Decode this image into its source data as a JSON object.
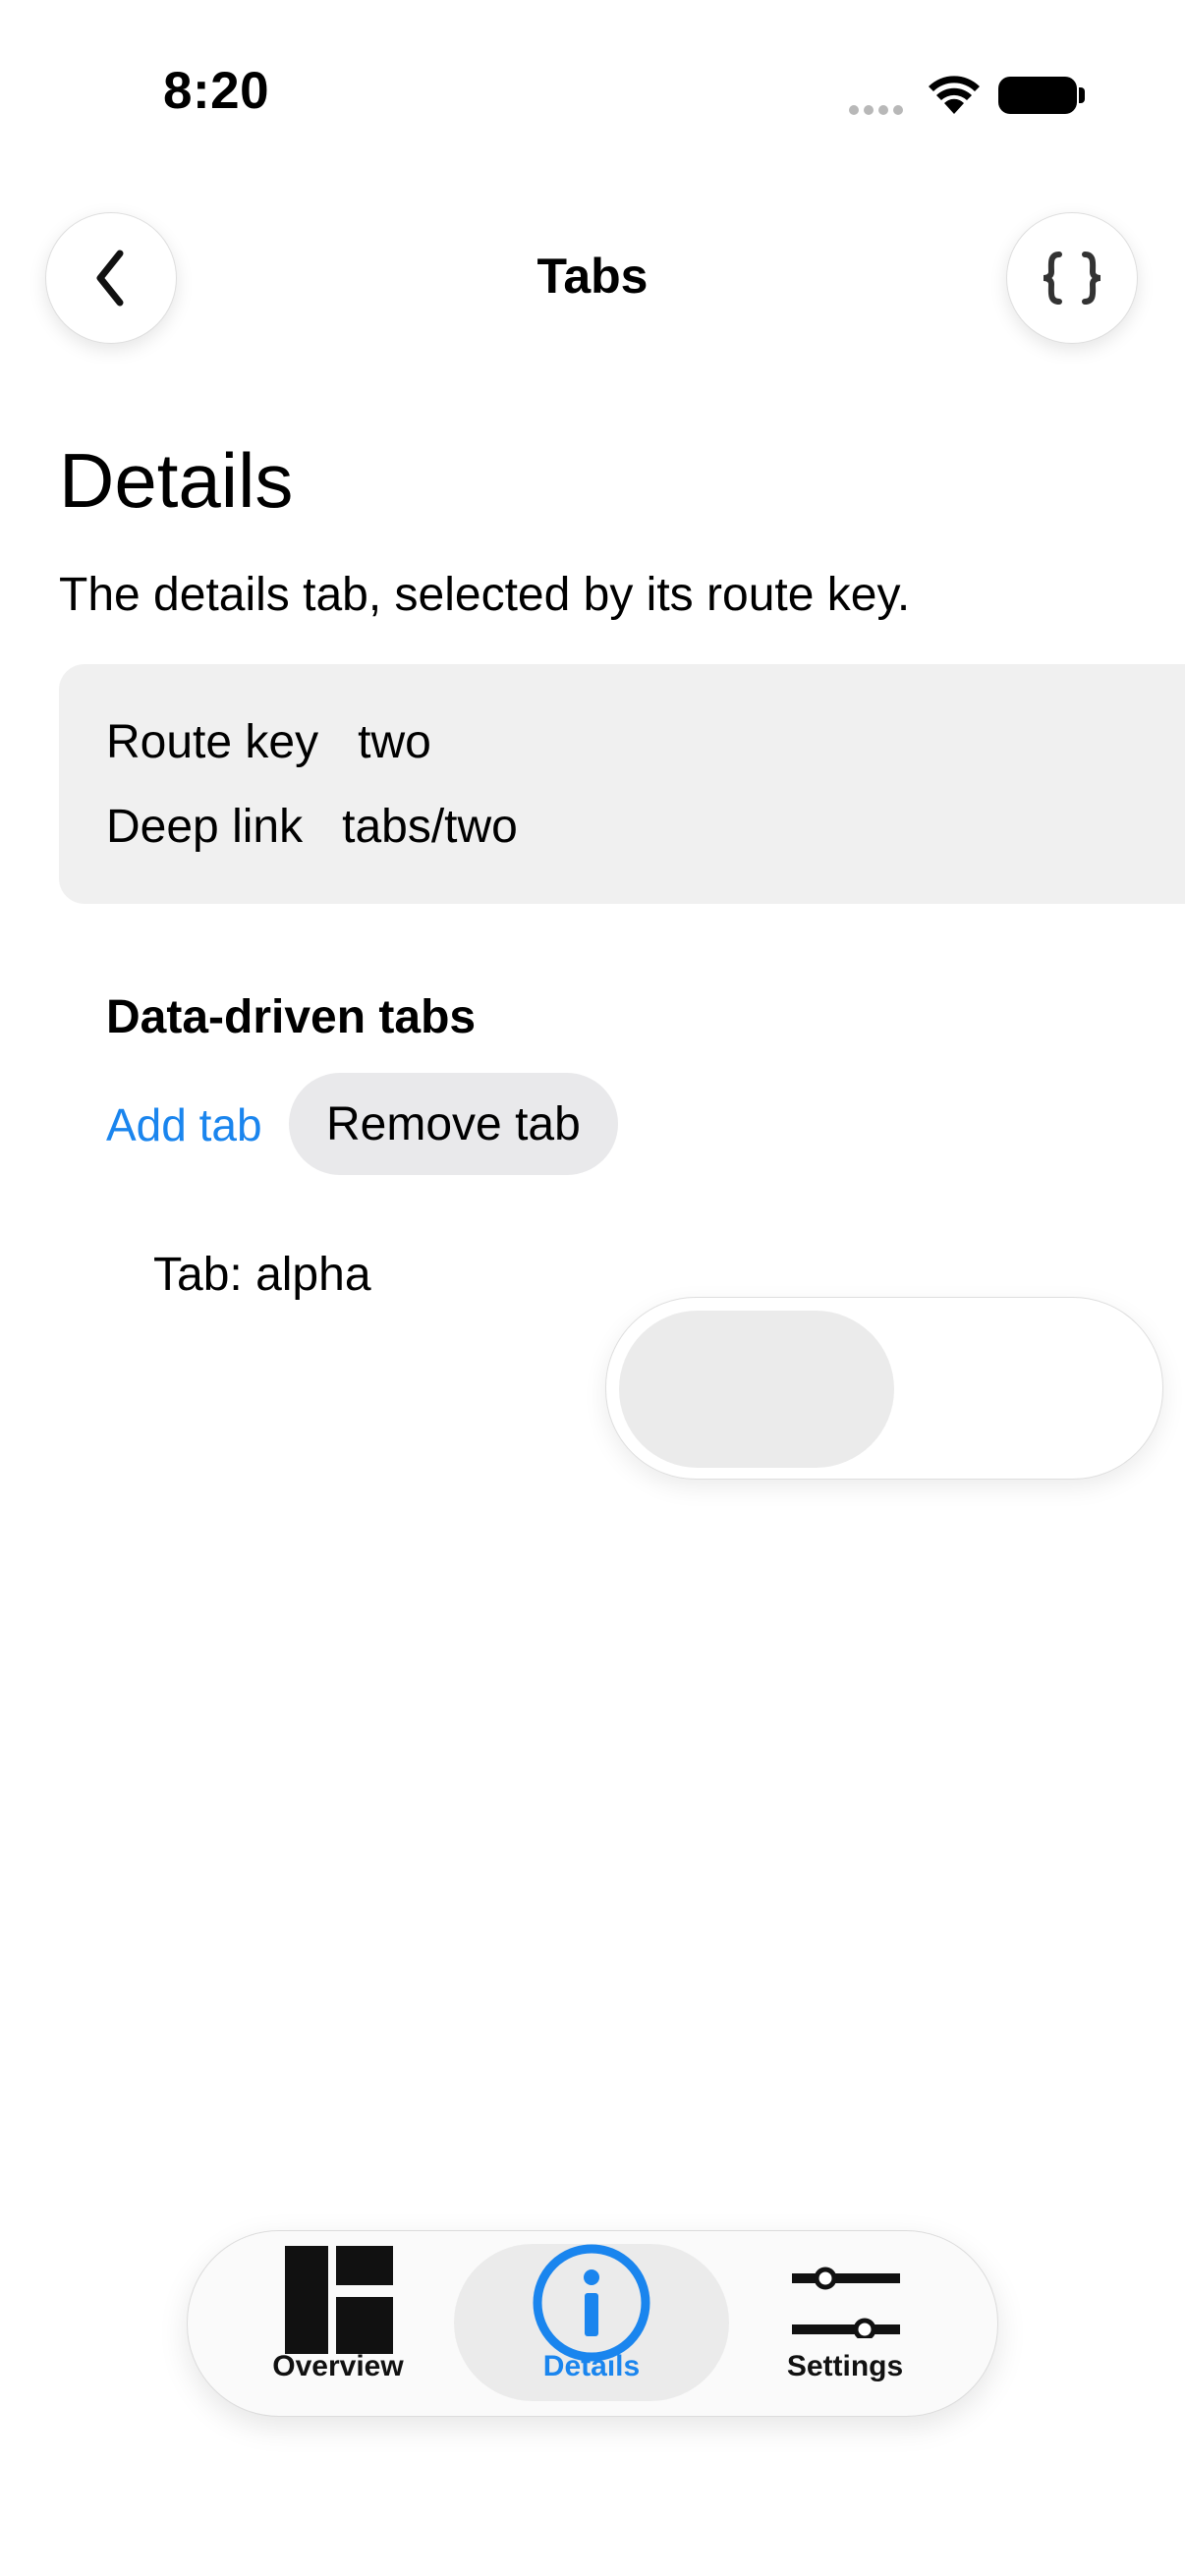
{
  "status_bar": {
    "time": "8:20"
  },
  "nav": {
    "title": "Tabs",
    "back_icon": "chevron-left-icon",
    "action_icon": "braces-icon"
  },
  "page": {
    "title": "Details",
    "subtitle": "The details tab, selected by its route key."
  },
  "info": {
    "route_key_label": "Route key",
    "route_key_value": "two",
    "deep_link_label": "Deep link",
    "deep_link_value": "tabs/two"
  },
  "data_driven": {
    "heading": "Data-driven tabs",
    "add_label": "Add tab",
    "remove_label": "Remove tab",
    "tab_text": "Tab: alpha"
  },
  "toggle": {
    "on": false
  },
  "tabbar": {
    "selected": "Details",
    "accent": "#1a85ee",
    "items": [
      {
        "label": "Overview",
        "icon": "overview-icon"
      },
      {
        "label": "Details",
        "icon": "info-icon"
      },
      {
        "label": "Settings",
        "icon": "sliders-icon"
      }
    ]
  }
}
